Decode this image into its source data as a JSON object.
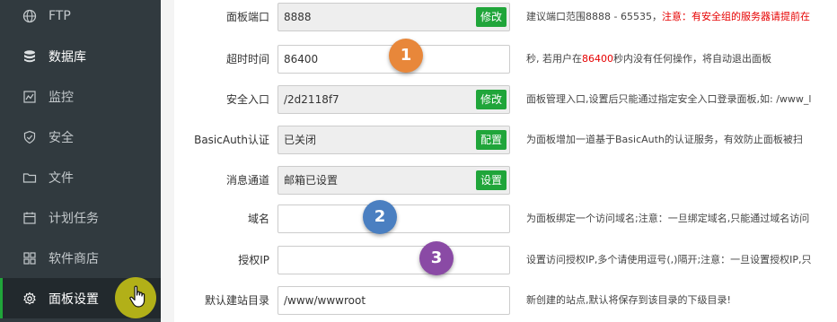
{
  "sidebar": {
    "items": [
      {
        "label": "FTP",
        "icon": "globe-icon",
        "active": false
      },
      {
        "label": "数据库",
        "icon": "database-icon",
        "active": false
      },
      {
        "label": "监控",
        "icon": "monitor-icon",
        "active": false
      },
      {
        "label": "安全",
        "icon": "shield-icon",
        "active": false
      },
      {
        "label": "文件",
        "icon": "folder-icon",
        "active": false
      },
      {
        "label": "计划任务",
        "icon": "calendar-icon",
        "active": false
      },
      {
        "label": "软件商店",
        "icon": "grid-icon",
        "active": false
      },
      {
        "label": "面板设置",
        "icon": "gear-icon",
        "active": true
      }
    ]
  },
  "settings": {
    "panel_port": {
      "label": "面板端口",
      "value": "8888",
      "button": "修改",
      "hint": "建议端口范围8888 - 65535，",
      "hint_warning": "注意：有安全组的服务器请提前在"
    },
    "timeout": {
      "label": "超时时间",
      "value": "86400",
      "hint_prefix": "秒, 若用户在",
      "hint_value": "86400",
      "hint_suffix": "秒内没有任何操作，将自动退出面板"
    },
    "security_entry": {
      "label": "安全入口",
      "value": "/2d2118f7",
      "button": "修改",
      "hint": "面板管理入口,设置后只能通过指定安全入口登录面板,如: /www_l"
    },
    "basic_auth": {
      "label": "BasicAuth认证",
      "value": "已关闭",
      "button": "配置",
      "hint": "为面板增加一道基于BasicAuth的认证服务，有效防止面板被扫"
    },
    "message_channel": {
      "label": "消息通道",
      "value": "邮箱已设置",
      "button": "设置"
    },
    "domain": {
      "label": "域名",
      "value": "",
      "hint": "为面板绑定一个访问域名;注意：一旦绑定域名,只能通过域名访问"
    },
    "authorized_ip": {
      "label": "授权IP",
      "value": "",
      "hint": "设置访问授权IP,多个请使用逗号(,)隔开;注意：一旦设置授权IP,只"
    },
    "default_site_dir": {
      "label": "默认建站目录",
      "value": "/www/wwwroot",
      "hint": "新创建的站点,默认将保存到该目录的下级目录!"
    }
  },
  "annotations": [
    {
      "number": "1",
      "color": "#e8873a"
    },
    {
      "number": "2",
      "color": "#4a7fc1"
    },
    {
      "number": "3",
      "color": "#8a4aa5"
    }
  ],
  "colors": {
    "accent": "#20a53a",
    "sidebar_bg": "#313a3f",
    "warning": "#e60000",
    "cursor_highlight": "#b2b018"
  }
}
